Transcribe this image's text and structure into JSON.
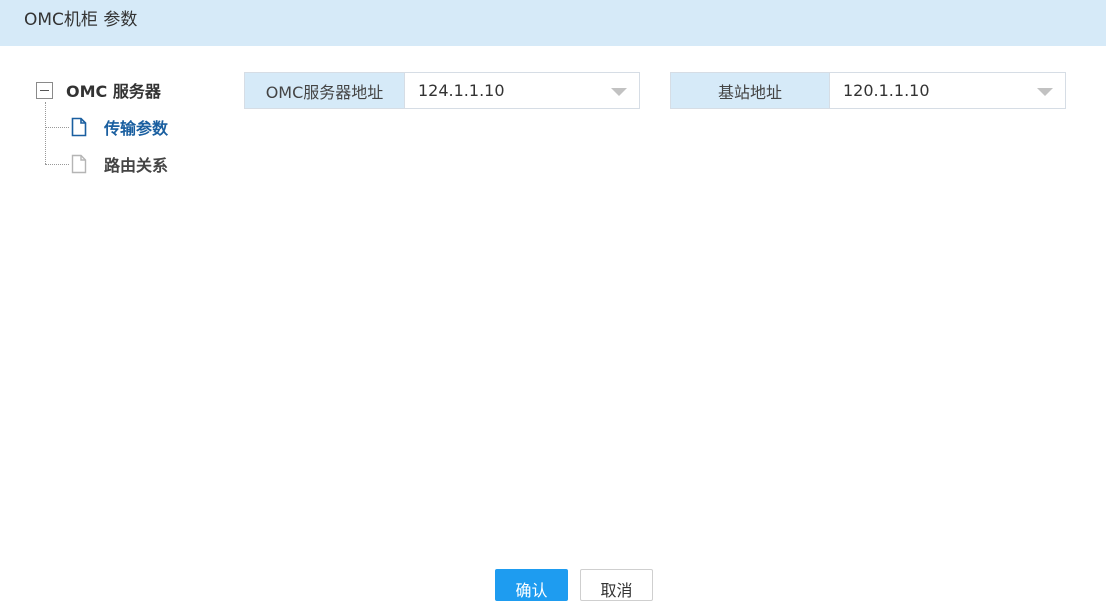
{
  "header": {
    "title": "OMC机柜 参数"
  },
  "tree": {
    "root_label": "OMC 服务器",
    "children": [
      {
        "label": "传输参数",
        "active": true
      },
      {
        "label": "路由关系",
        "active": false
      }
    ]
  },
  "fields": {
    "omc_server": {
      "label": "OMC服务器地址",
      "value": "124.1.1.10"
    },
    "base_station": {
      "label": "基站地址",
      "value": "120.1.1.10"
    }
  },
  "buttons": {
    "confirm": "确认",
    "cancel": "取消"
  },
  "colors": {
    "header_bg": "#d6eaf8",
    "accent": "#1e9cf0",
    "active_text": "#1a5fa0"
  }
}
